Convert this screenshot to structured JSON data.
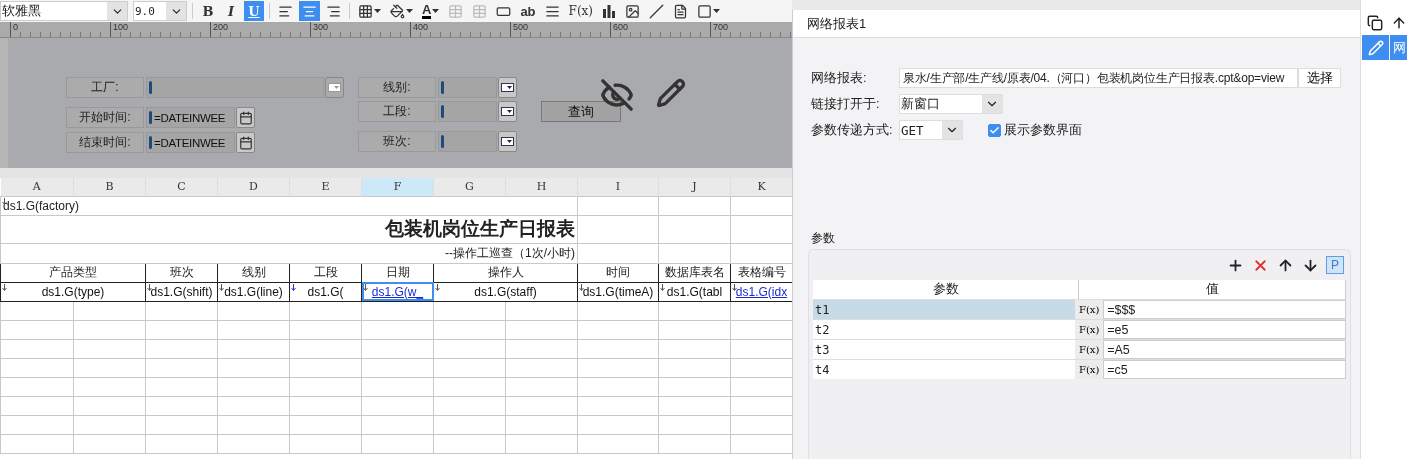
{
  "toolbar": {
    "font": "软雅黑",
    "size": "9.0",
    "format_buttons": [
      {
        "kind": "bold",
        "label": "B",
        "selected": false
      },
      {
        "kind": "italic",
        "label": "I",
        "selected": false
      },
      {
        "kind": "underline",
        "label": "U",
        "selected": true
      }
    ],
    "align_buttons": [
      {
        "kind": "left",
        "selected": false
      },
      {
        "kind": "center",
        "selected": true
      },
      {
        "kind": "right",
        "selected": false
      }
    ],
    "tools": [
      {
        "kind": "border",
        "disabled": false
      },
      {
        "kind": "fill",
        "disabled": false
      },
      {
        "kind": "font-color",
        "label": "A",
        "disabled": false
      },
      {
        "kind": "merge",
        "disabled": true
      },
      {
        "kind": "split",
        "disabled": true
      },
      {
        "kind": "textfield",
        "disabled": false
      },
      {
        "kind": "text",
        "label": "ab",
        "disabled": false
      },
      {
        "kind": "paragraph",
        "disabled": false
      },
      {
        "kind": "formula",
        "label": "F(x)",
        "disabled": false
      },
      {
        "kind": "chart",
        "disabled": false
      },
      {
        "kind": "image",
        "disabled": false
      },
      {
        "kind": "slash",
        "disabled": false
      },
      {
        "kind": "subreport",
        "disabled": false
      },
      {
        "kind": "frame",
        "disabled": false
      }
    ]
  },
  "ruler": [
    "0",
    "100",
    "200",
    "300",
    "400",
    "500",
    "600",
    "700"
  ],
  "param_form": {
    "widgets": [
      {
        "kind": "combo",
        "label": "工厂:",
        "disabled": true
      },
      {
        "kind": "date",
        "label": "开始时间:",
        "value": "=DATEINWEE"
      },
      {
        "kind": "date",
        "label": "结束时间:",
        "value": "=DATEINWEE"
      },
      {
        "kind": "combo",
        "label": "线别:",
        "disabled": false
      },
      {
        "kind": "combo",
        "label": "工段:",
        "disabled": false
      },
      {
        "kind": "combo",
        "label": "班次:",
        "disabled": false
      }
    ],
    "query_button": "查询"
  },
  "sheet": {
    "columns": [
      {
        "letter": "A",
        "selected": false
      },
      {
        "letter": "B",
        "selected": false
      },
      {
        "letter": "C",
        "selected": false
      },
      {
        "letter": "D",
        "selected": false
      },
      {
        "letter": "E",
        "selected": false
      },
      {
        "letter": "F",
        "selected": true
      },
      {
        "letter": "G",
        "selected": false
      },
      {
        "letter": "H",
        "selected": false
      },
      {
        "letter": "I",
        "selected": false
      },
      {
        "letter": "J",
        "selected": false
      },
      {
        "letter": "K",
        "selected": false
      }
    ],
    "factory_cell": "ds1.G(factory)",
    "title": "包装机岗位生产日报表",
    "subtitle": "--操作工巡查（1次/小时)",
    "headers": [
      "产品类型",
      "班次",
      "线别",
      "工段",
      "日期",
      "操作人",
      "时间",
      "数据库表名",
      "表格编号"
    ],
    "data": [
      {
        "text": "ds1.G(type)",
        "link": false,
        "selected": false
      },
      {
        "text": "ds1.G(shift)",
        "link": false,
        "selected": false
      },
      {
        "text": "ds1.G(line)",
        "link": false,
        "selected": false
      },
      {
        "text": "ds1.G(",
        "link": false,
        "selected": false
      },
      {
        "text": "ds1.G(w_",
        "link": true,
        "selected": true
      },
      {
        "text": "ds1.G(staff)",
        "link": false,
        "selected": false
      },
      {
        "text": "ds1.G(timeA)",
        "link": false,
        "selected": false
      },
      {
        "text": "ds1.G(tabl",
        "link": false,
        "selected": false
      },
      {
        "text": "ds1.G(idx",
        "link": true,
        "selected": false
      }
    ]
  },
  "panel": {
    "tab": "网络报表1",
    "report": {
      "label": "网络报表:",
      "value": "泉水/生产部/生产线/原表/04.（河口）包装机岗位生产日报表.cpt&op=view",
      "button": "选择"
    },
    "open_in": {
      "label": "链接打开于:",
      "value": "新窗口"
    },
    "method": {
      "label": "参数传递方式:",
      "value": "GET"
    },
    "show_params": {
      "label": "展示参数界面",
      "checked": true
    },
    "params": {
      "title": "参数",
      "tools": [
        {
          "kind": "add"
        },
        {
          "kind": "delete"
        },
        {
          "kind": "up"
        },
        {
          "kind": "down"
        },
        {
          "kind": "param",
          "label": "P"
        }
      ],
      "columns": [
        "参数",
        "值"
      ],
      "rows": [
        {
          "name": "t1",
          "formula_button": "F(x)",
          "value": "=$$$",
          "selected": true
        },
        {
          "name": "t2",
          "formula_button": "F(x)",
          "value": "=e5",
          "selected": false
        },
        {
          "name": "t3",
          "formula_button": "F(x)",
          "value": "=A5",
          "selected": false
        },
        {
          "name": "t4",
          "formula_button": "F(x)",
          "value": "=c5",
          "selected": false
        }
      ]
    }
  },
  "side_strip": {
    "items": [
      {
        "kind": "copy",
        "selected": false
      },
      {
        "kind": "up",
        "selected": false
      },
      {
        "kind": "edit",
        "selected": true
      },
      {
        "kind": "text",
        "label": "网",
        "selected": true
      }
    ]
  }
}
